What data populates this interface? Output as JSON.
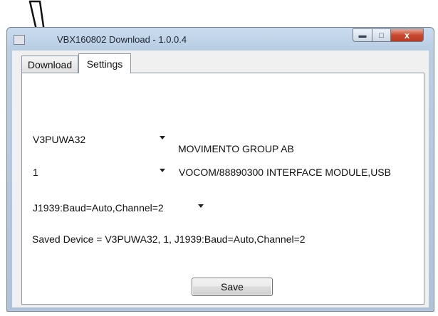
{
  "window": {
    "title": "VBX160802 Download - 1.0.0.4",
    "controls": {
      "minimize_icon": "minimize-icon",
      "maximize_icon": "maximize-icon",
      "close_icon": "close-icon",
      "close_glyph": "x"
    }
  },
  "tabs": [
    {
      "label": "Download",
      "selected": false
    },
    {
      "label": "Settings",
      "selected": true
    }
  ],
  "settings": {
    "device": {
      "value": "V3PUWA32",
      "description": "MOVIMENTO GROUP AB"
    },
    "interface": {
      "value": "1",
      "description": "VOCOM/88890300 INTERFACE MODULE,USB"
    },
    "protocol": {
      "value": "J1939:Baud=Auto,Channel=2"
    },
    "saved_device": "Saved Device = V3PUWA32, 1, J1939:Baud=Auto,Channel=2",
    "save_label": "Save"
  },
  "annotation": {
    "icon": "arrow-pointer-icon",
    "color": "#000000"
  }
}
